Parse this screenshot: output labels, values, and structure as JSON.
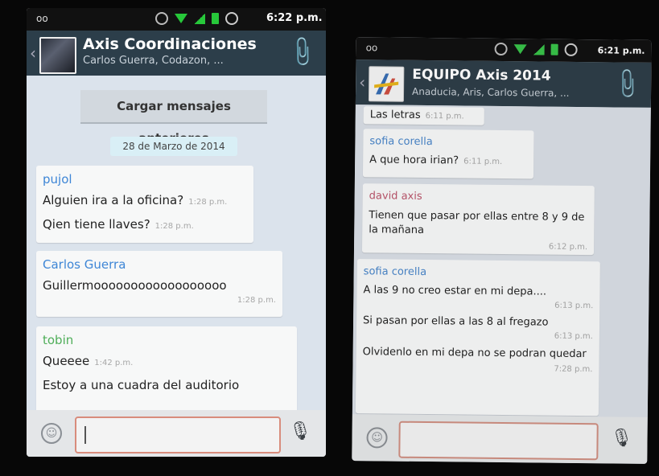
{
  "left": {
    "status": {
      "voicemail": "oo",
      "time": "6:22 p.m."
    },
    "header": {
      "back": "‹",
      "title": "Axis Coordinaciones",
      "subtitle": "Carlos Guerra, Codazon, ..."
    },
    "load_more": "Cargar mensajes anteriores",
    "date": "28 de Marzo de 2014",
    "messages": [
      {
        "sender": "pujol",
        "color": "#3e86d6",
        "lines": [
          {
            "text": "Alguien ira a la oficina?",
            "time": "1:28 p.m."
          },
          {
            "text": "Qien tiene llaves?",
            "time": "1:28 p.m."
          }
        ]
      },
      {
        "sender": "Carlos Guerra",
        "color": "#3e86d6",
        "lines": [
          {
            "text": "Guillermoooooooooooooooooo",
            "time": "1:28 p.m."
          }
        ]
      },
      {
        "sender": "tobin",
        "color": "#4fae59",
        "lines": [
          {
            "text": "Queeee",
            "time": "1:42 p.m."
          },
          {
            "text": "Estoy a una cuadra del auditorio",
            "time": ""
          }
        ]
      }
    ],
    "input": {
      "placeholder": "",
      "value": ""
    }
  },
  "right": {
    "status": {
      "voicemail": "oo",
      "time": "6:21 p.m."
    },
    "header": {
      "back": "‹",
      "title": "EQUIPO Axis 2014",
      "subtitle": "Anaducia, Aris, Carlos Guerra, ..."
    },
    "messages": [
      {
        "sender": "",
        "color": "#555555",
        "lines": [
          {
            "text": "Las letras",
            "time": "6:11 p.m."
          }
        ]
      },
      {
        "sender": "sofia corella",
        "color": "#3e86d6",
        "lines": [
          {
            "text": "A que hora irian?",
            "time": "6:11 p.m."
          }
        ]
      },
      {
        "sender": "david axis",
        "color": "#c8506a",
        "lines": [
          {
            "text": "Tienen que pasar por ellas entre 8 y 9 de la mañana",
            "time": "6:12 p.m."
          }
        ]
      },
      {
        "sender": "sofia corella",
        "color": "#3e86d6",
        "lines": [
          {
            "text": "A las 9 no creo estar en mi depa....",
            "time": "6:13 p.m."
          },
          {
            "text": "Si pasan por ellas a las 8 al fregazo",
            "time": "6:13 p.m."
          },
          {
            "text": "Olvidenlo en mi depa no se podran quedar",
            "time": "7:28 p.m."
          }
        ]
      }
    ]
  },
  "icons": {
    "attach": "paperclip-icon",
    "emoji": "smiley-icon",
    "mic": "microphone-icon"
  }
}
